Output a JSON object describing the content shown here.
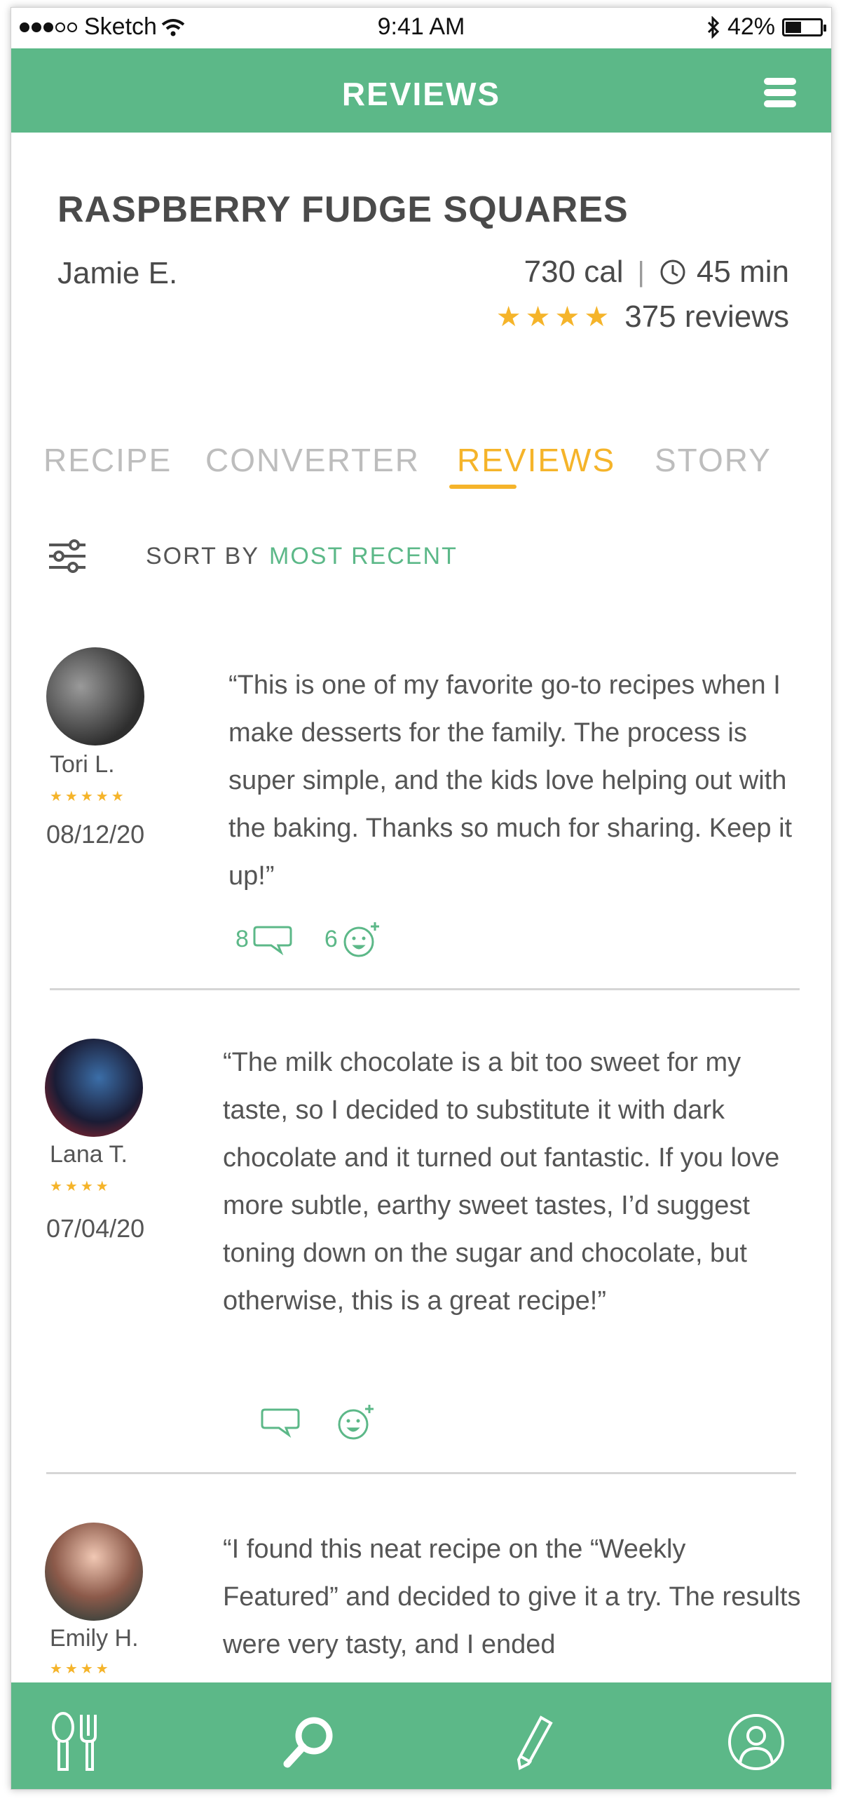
{
  "status_bar": {
    "carrier": "Sketch",
    "time": "9:41 AM",
    "battery": "42%"
  },
  "header": {
    "title": "REVIEWS"
  },
  "recipe": {
    "title": "RASPBERRY FUDGE SQUARES",
    "author": "Jamie E.",
    "calories": "730 cal",
    "separator": "|",
    "time": "45 min",
    "stars": "★★★★",
    "review_count": "375 reviews"
  },
  "tabs": [
    "RECIPE",
    "CONVERTER",
    "REVIEWS",
    "STORY"
  ],
  "active_tab": "REVIEWS",
  "sort": {
    "label": "SORT BY",
    "value": "MOST RECENT"
  },
  "reviews": [
    {
      "name": "Tori L.",
      "stars": "★★★★★",
      "rating": 5,
      "date": "08/12/20",
      "text": "“This is one of my favorite go-to recipes when I make desserts for the family. The process is super simple, and the kids love helping out with the baking. Thanks so much for sharing. Keep it up!”",
      "comments": "8",
      "reactions": "6"
    },
    {
      "name": "Lana T.",
      "stars": "★★★★",
      "rating": 4,
      "date": "07/04/20",
      "text": "“The milk chocolate is a bit too sweet for my taste, so I decided to substitute it with dark chocolate and it turned out fantastic. If you love more subtle, earthy sweet tastes, I’d suggest toning down on the sugar and chocolate, but otherwise, this is a great recipe!”",
      "comments": "",
      "reactions": ""
    },
    {
      "name": "Emily H.",
      "stars": "★★★★",
      "rating": 4,
      "date": "",
      "text": "“I found this neat recipe on the “Weekly Featured” and decided to give it a try. The results were very tasty, and I ended",
      "comments": "",
      "reactions": ""
    }
  ],
  "icons": {
    "menu": "hamburger-icon",
    "filter": "filter-sliders-icon",
    "clock": "clock-icon",
    "comment": "comment-bubble-icon",
    "reaction": "add-reaction-icon",
    "nav": [
      "utensils-icon",
      "search-icon",
      "pencil-icon",
      "profile-icon"
    ]
  },
  "colors": {
    "brand_green": "#5cb888",
    "accent_yellow": "#f5b42a"
  }
}
